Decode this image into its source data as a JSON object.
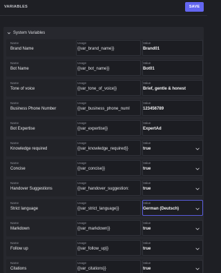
{
  "header": {
    "title": "VARIABLES",
    "save_label": "SAVE"
  },
  "section": {
    "title": "System Variables"
  },
  "captions": {
    "name": "Name",
    "usage": "Usage",
    "value": "Value"
  },
  "rows": [
    {
      "name": "Brand Name",
      "usage": "{{var_brand_name}}",
      "value": "Brand01",
      "type": "text"
    },
    {
      "name": "Bot Name",
      "usage": "{{var_bot_name}}",
      "value": "Bot01",
      "type": "text"
    },
    {
      "name": "Tone of voice",
      "usage": "{{var_tone_of_voice}}",
      "value": "Brief, gentle & honest",
      "type": "text"
    },
    {
      "name": "Business Phone Number",
      "usage": "{{var_business_phone_numl",
      "value": "123456789",
      "type": "text"
    },
    {
      "name": "Bot Expertise",
      "usage": "{{var_expertise}}",
      "value": "ExpertAd",
      "type": "text"
    },
    {
      "name": "Knowledge required",
      "usage": "{{var_knowledge_required}}",
      "value": "true",
      "type": "select"
    },
    {
      "name": "Concise",
      "usage": "{{var_concise}}",
      "value": "true",
      "type": "select"
    },
    {
      "name": "Handover Suggestions",
      "usage": "{{var_handover_suggestion:",
      "value": "true",
      "type": "select"
    },
    {
      "name": "Strict language",
      "usage": "{{var_strict_language}}",
      "value": "German (Deutsch)",
      "type": "select",
      "active": true
    },
    {
      "name": "Markdown",
      "usage": "{{var_markdown}}",
      "value": "true",
      "type": "select"
    },
    {
      "name": "Follow up",
      "usage": "{{var_follow_up}}",
      "value": "true",
      "type": "select"
    },
    {
      "name": "Citations",
      "usage": "{{var_citations}}",
      "value": "true",
      "type": "select"
    }
  ],
  "colors": {
    "accent": "#6366f1",
    "background": "#1e1f24",
    "panel": "#27282e"
  },
  "icons": {
    "section_toggle": "chevron-down-icon",
    "select": "chevron-down-icon"
  }
}
